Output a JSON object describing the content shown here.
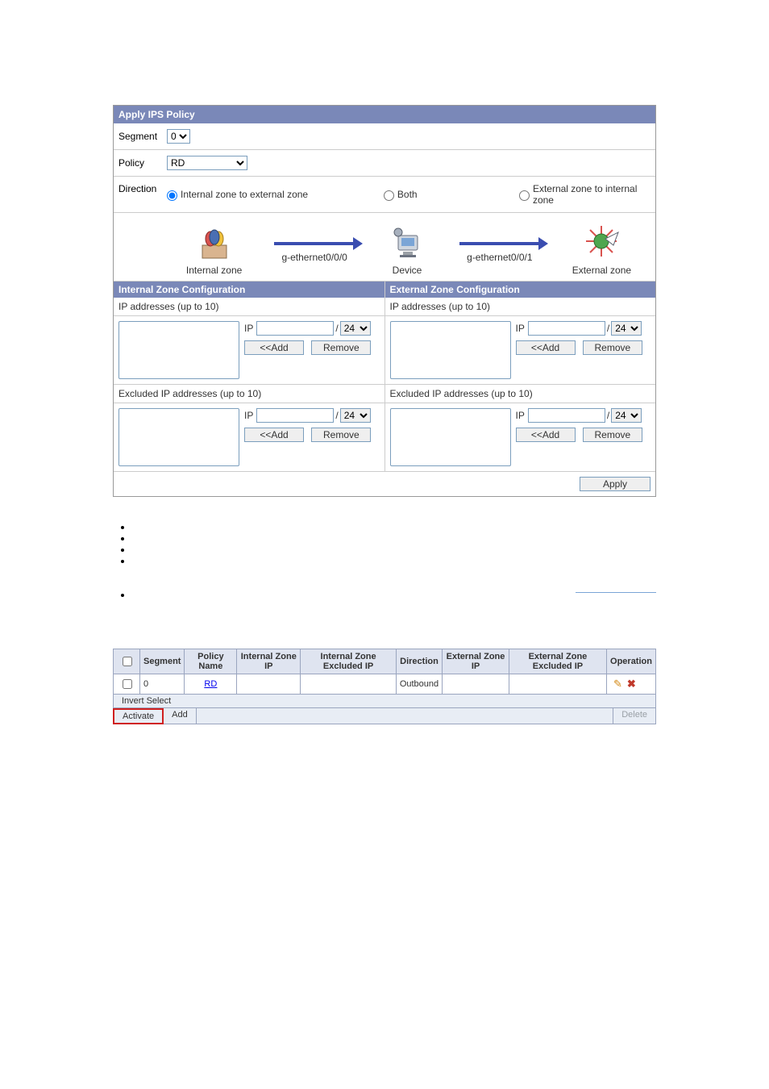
{
  "panel": {
    "title": "Apply IPS Policy",
    "segment_label": "Segment",
    "segment_value": "0",
    "policy_label": "Policy",
    "policy_value": "RD",
    "direction_label": "Direction",
    "direction_options": {
      "i2e": "Internal zone to external zone",
      "both": "Both",
      "e2i": "External zone to internal zone"
    },
    "diagram": {
      "internal_label": "Internal zone",
      "device_label": "Device",
      "external_label": "External zone",
      "if_left": "g-ethernet0/0/0",
      "if_right": "g-ethernet0/0/1"
    },
    "zones": {
      "internal_title": "Internal Zone Configuration",
      "external_title": "External Zone Configuration",
      "ip_heading": "IP addresses (up to 10)",
      "excl_heading": "Excluded IP addresses (up to 10)",
      "ip_label": "IP",
      "mask_default": "24",
      "add_btn": "<<Add",
      "remove_btn": "Remove"
    },
    "apply_btn": "Apply"
  },
  "grid": {
    "headers": {
      "segment": "Segment",
      "policy": "Policy Name",
      "iz_ip": "Internal Zone IP",
      "iz_ex": "Internal Zone Excluded IP",
      "dir": "Direction",
      "ez_ip": "External Zone IP",
      "ez_ex": "External Zone Excluded IP",
      "op": "Operation"
    },
    "row": {
      "segment": "0",
      "policy": "RD",
      "iz_ip": "",
      "iz_ex": "",
      "dir": "Outbound",
      "ez_ip": "",
      "ez_ex": ""
    },
    "invert": "Invert Select",
    "activate": "Activate",
    "add": "Add",
    "delete": "Delete"
  }
}
